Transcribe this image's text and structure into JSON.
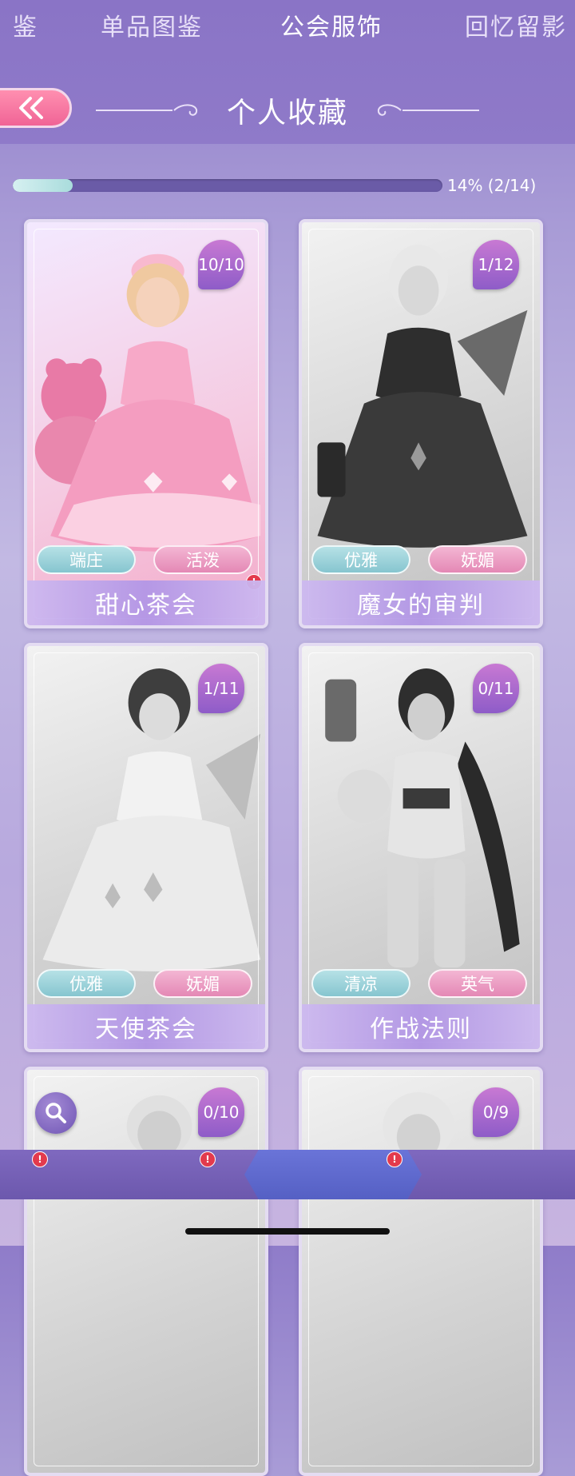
{
  "header": {
    "title": "个人收藏",
    "back_icon": "double-chevron-left-icon"
  },
  "progress": {
    "fraction": 0.14,
    "label": "14% (2/14)"
  },
  "cards": [
    {
      "name": "甜心茶会",
      "count": "10/10",
      "tags": [
        "端庄",
        "活泼"
      ],
      "owned": true,
      "alert": true
    },
    {
      "name": "魔女的审判",
      "count": "1/12",
      "tags": [
        "优雅",
        "妩媚"
      ],
      "owned": false,
      "alert": false
    },
    {
      "name": "天使茶会",
      "count": "1/11",
      "tags": [
        "优雅",
        "妩媚"
      ],
      "owned": false,
      "alert": false
    },
    {
      "name": "作战法则",
      "count": "0/11",
      "tags": [
        "清凉",
        "英气"
      ],
      "owned": false,
      "alert": false
    },
    {
      "count": "0/10",
      "owned": false
    },
    {
      "count": "0/9",
      "owned": false
    }
  ],
  "bottom_nav": {
    "items": [
      {
        "label": "鉴",
        "alert": true
      },
      {
        "label": "单品图鉴",
        "alert": true
      },
      {
        "label": "公会服饰",
        "alert": true,
        "active": true
      },
      {
        "label": "回忆留影",
        "alert": false
      }
    ]
  },
  "colors": {
    "accent_pink": "#f06496",
    "accent_purple": "#8e5cc8",
    "alert_red": "#e33a4d"
  }
}
